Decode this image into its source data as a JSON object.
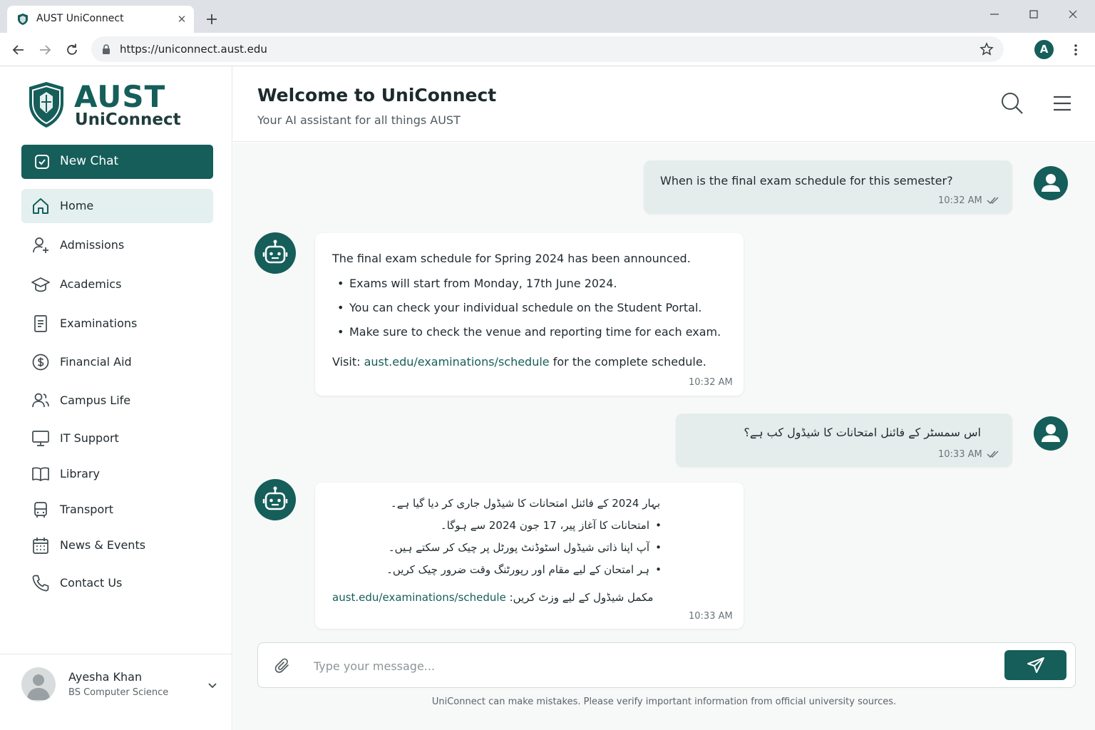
{
  "browser": {
    "tab_title": "AUST UniConnect",
    "tab_close": "✕",
    "url": "https://uniconnect.aust.edu",
    "profile_initial": "A"
  },
  "brand": {
    "name": "AUST",
    "product": "UniConnect",
    "accent": "#155e5a"
  },
  "sidebar": {
    "new_chat_label": "New Chat",
    "items": [
      {
        "label": "Home",
        "icon": "home-icon",
        "active": true
      },
      {
        "label": "Admissions",
        "icon": "user-plus-icon"
      },
      {
        "label": "Academics",
        "icon": "graduation-cap-icon"
      },
      {
        "label": "Examinations",
        "icon": "document-icon"
      },
      {
        "label": "Financial Aid",
        "icon": "dollar-circle-icon"
      },
      {
        "label": "Campus Life",
        "icon": "users-icon"
      },
      {
        "label": "IT Support",
        "icon": "monitor-icon"
      },
      {
        "label": "Library",
        "icon": "book-open-icon"
      },
      {
        "label": "Transport",
        "icon": "bus-icon"
      },
      {
        "label": "News & Events",
        "icon": "calendar-icon"
      },
      {
        "label": "Contact Us",
        "icon": "phone-icon"
      }
    ],
    "user": {
      "name": "Ayesha Khan",
      "program": "BS Computer Science"
    }
  },
  "header": {
    "title": "Welcome to UniConnect",
    "subtitle": "Your AI assistant for all things AUST"
  },
  "messages": [
    {
      "role": "user",
      "text": "When is the final exam schedule for this semester?",
      "time": "10:32 AM"
    },
    {
      "role": "bot",
      "intro": "The final exam schedule for Spring 2024 has been announced.",
      "bullets": [
        "Exams will start from Monday, 17th June 2024.",
        "You can check your individual schedule on the Student Portal.",
        "Make sure to check the venue and reporting time for each exam."
      ],
      "visit_prefix": "Visit:",
      "link": "aust.edu/examinations/schedule",
      "visit_suffix": "for the complete schedule.",
      "time": "10:32 AM"
    },
    {
      "role": "user",
      "text": "اس سمسٹر کے فائنل امتحانات کا شیڈول کب ہے؟",
      "time": "10:33 AM"
    },
    {
      "role": "bot",
      "intro": "بہار 2024 کے فائنل امتحانات کا شیڈول جاری کر دیا گیا ہے۔",
      "bullets": [
        "امتحانات کا آغاز پیر، 17 جون 2024 سے ہوگا۔",
        "آپ اپنا ذاتی شیڈول اسٹوڈنٹ پورٹل پر چیک کر سکتے ہیں۔",
        "ہر امتحان کے لیے مقام اور رپورٹنگ وقت ضرور چیک کریں۔"
      ],
      "visit_prefix": "مکمل شیڈول کے لیے وزٹ کریں:",
      "link": "aust.edu/examinations/schedule",
      "time": "10:33 AM"
    }
  ],
  "composer": {
    "placeholder": "Type your message..."
  },
  "disclaimer": "UniConnect can make mistakes. Please verify important information from official university sources."
}
